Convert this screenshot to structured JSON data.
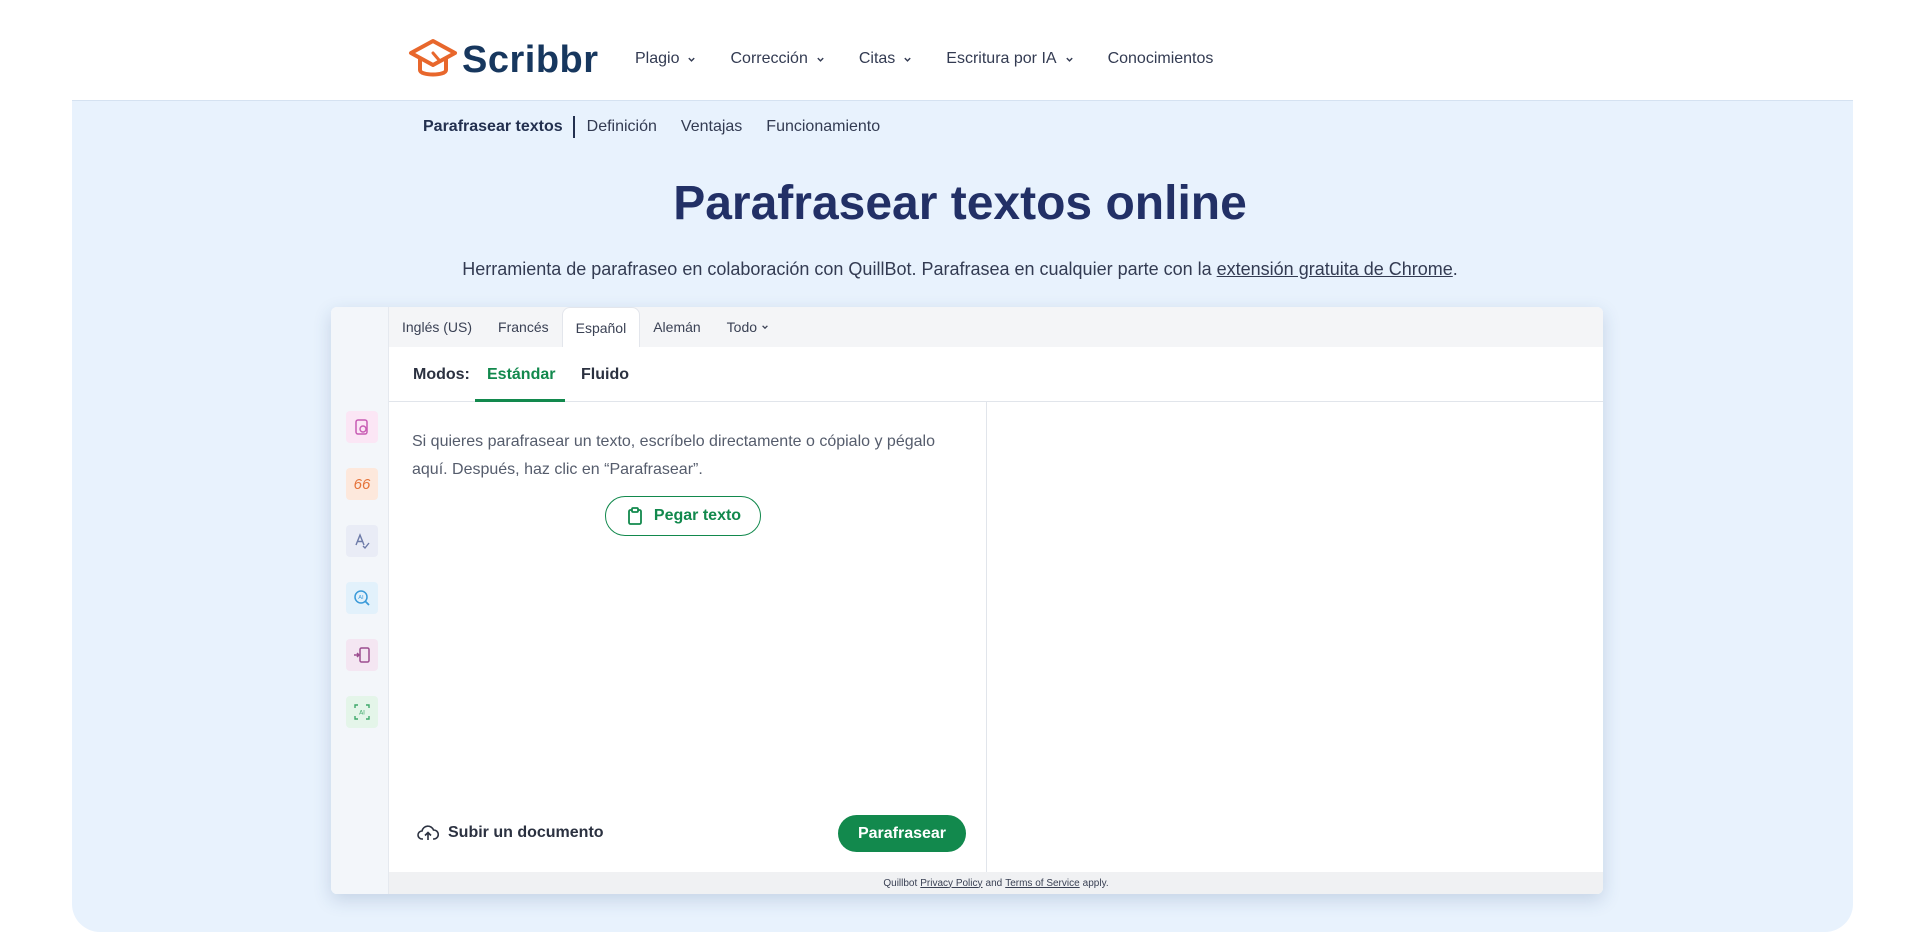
{
  "brand": {
    "name": "Scribbr",
    "logo_color": "#e8672c",
    "text_color": "#17375e"
  },
  "nav": {
    "items": [
      {
        "label": "Plagio",
        "has_dropdown": true
      },
      {
        "label": "Corrección",
        "has_dropdown": true
      },
      {
        "label": "Citas",
        "has_dropdown": true
      },
      {
        "label": "Escritura por IA",
        "has_dropdown": true
      },
      {
        "label": "Conocimientos",
        "has_dropdown": false
      }
    ]
  },
  "subnav": {
    "active": "Parafrasear textos",
    "items": [
      "Definición",
      "Ventajas",
      "Funcionamiento"
    ]
  },
  "hero": {
    "title": "Parafrasear textos online",
    "subtitle_prefix": "Herramienta de parafraseo en colaboración con QuillBot. Parafrasea en cualquier parte con la ",
    "subtitle_link": "extensión gratuita de Chrome",
    "subtitle_suffix": "."
  },
  "tool": {
    "sidebar_icons": [
      {
        "name": "paraphraser-icon",
        "bg": "#fbe6f5",
        "color": "#c85bb4"
      },
      {
        "name": "quote-icon",
        "label": "66",
        "bg": "#fde8dc",
        "color": "#e5733a"
      },
      {
        "name": "grammar-icon",
        "bg": "#e9ecf6",
        "color": "#6c7aa8"
      },
      {
        "name": "ai-detector-icon",
        "bg": "#e2f1fb",
        "color": "#3a9ad9"
      },
      {
        "name": "translator-icon",
        "bg": "#f4e6f2",
        "color": "#9c4d8f"
      },
      {
        "name": "ai-humanizer-icon",
        "bg": "#e4f5e9",
        "color": "#3fa86a"
      }
    ],
    "languages": {
      "tabs": [
        "Inglés (US)",
        "Francés",
        "Español",
        "Alemán"
      ],
      "active": "Español",
      "more_label": "Todo"
    },
    "modes": {
      "label": "Modos:",
      "options": [
        "Estándar",
        "Fluido"
      ],
      "active": "Estándar"
    },
    "input": {
      "placeholder": "Si quieres parafrasear un texto, escríbelo directamente o cópialo y pégalo aquí. Después, haz clic en “Parafrasear”.",
      "paste_label": "Pegar texto",
      "upload_label": "Subir un documento",
      "submit_label": "Parafrasear"
    },
    "footer": {
      "prefix": "Quillbot",
      "privacy": "Privacy Policy",
      "and": "and",
      "terms": "Terms of Service",
      "suffix": "apply."
    },
    "accent": "#12894d"
  }
}
